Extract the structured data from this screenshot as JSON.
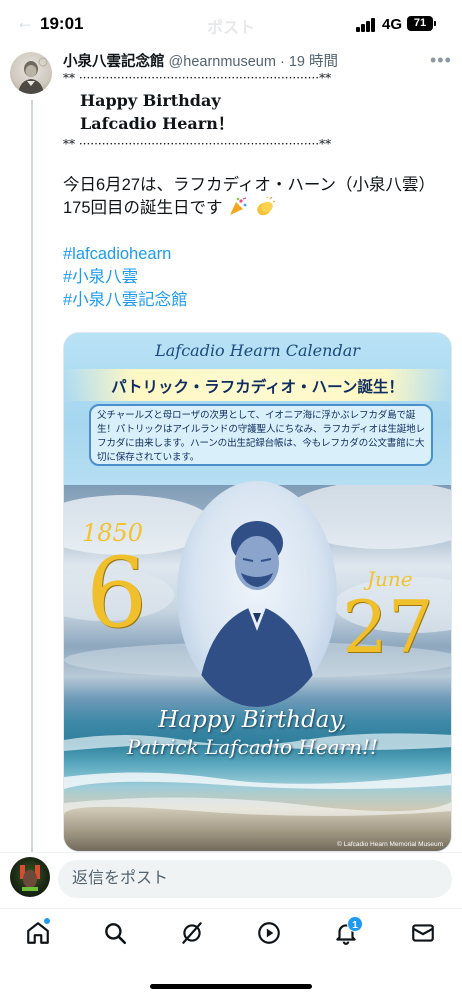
{
  "status_bar": {
    "time": "19:01",
    "screen_title": "ポスト",
    "network": "4G",
    "battery": "71"
  },
  "tweet": {
    "author_name": "小泉八雲記念館",
    "author_handle": "@hearnmuseum",
    "separator": "·",
    "time_ago": "19 時間",
    "deco_line": "** ·······························································**",
    "birthday_line1": "Happy Birthday",
    "birthday_line2": "Lafcadio Hearn！",
    "text_line1": "今日6月27は、ラフカディオ・ハーン（小泉八雲）",
    "text_line2": "175回目の誕生日です",
    "hashtags": [
      "#lafcadiohearn",
      "#小泉八雲",
      "#小泉八雲記念館"
    ]
  },
  "media": {
    "calendar_title": "Lafcadio Hearn Calendar",
    "headline": "パトリック・ラフカディオ・ハーン誕生！",
    "description": "父チャールズと母ローザの次男として、イオニア海に浮かぶレフカダ島で誕生！パトリックはアイルランドの守護聖人にちなみ、ラフカディオは生誕地レフカダに由来します。ハーンの出生記録台帳は、今もレフカダの公文書館に大切に保存されています。",
    "year": "1850",
    "month_number": "6",
    "month_name": "June",
    "day_number": "27",
    "greeting_line1": "Happy Birthday,",
    "greeting_line2": "Patrick Lafcadio Hearn!!",
    "copyright": "© Lafcadio Hearn Memorial Museum"
  },
  "reply": {
    "placeholder": "返信をポスト"
  },
  "nav": {
    "notification_count": "1"
  },
  "icons": {
    "back": "back-arrow-icon",
    "more": "more-dots-icon",
    "home": "home-icon",
    "search": "search-icon",
    "grok": "grok-icon",
    "video": "video-play-icon",
    "notifications": "bell-icon",
    "messages": "mail-icon"
  },
  "colors": {
    "accent": "#1d9bf0",
    "text": "#0f1419",
    "muted": "#536471",
    "gold": "#f0c02c"
  }
}
